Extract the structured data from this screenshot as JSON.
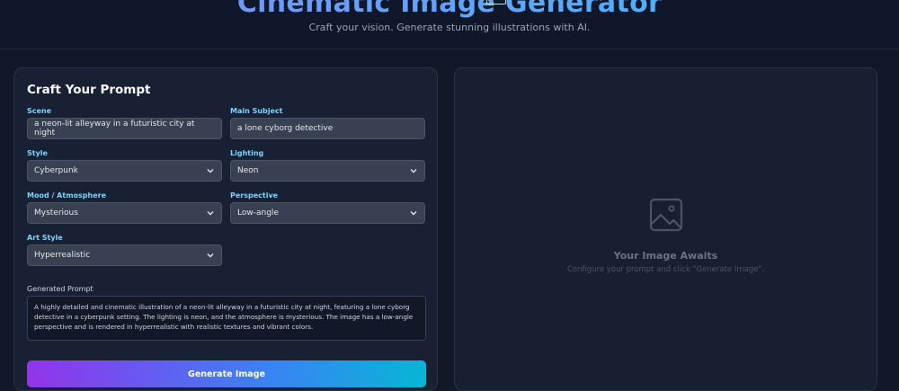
{
  "header": {
    "title": "Cinematic Image Generator",
    "subtitle": "Craft your vision. Generate stunning illustrations with AI."
  },
  "prompt_panel": {
    "title": "Craft Your Prompt",
    "scene": {
      "label": "Scene",
      "value": "a neon-lit alleyway in a futuristic city at night"
    },
    "subject": {
      "label": "Main Subject",
      "value": "a lone cyborg detective"
    },
    "style": {
      "label": "Style",
      "selected": "Cyberpunk"
    },
    "lighting": {
      "label": "Lighting",
      "selected": "Neon"
    },
    "mood": {
      "label": "Mood / Atmosphere",
      "selected": "Mysterious"
    },
    "perspective": {
      "label": "Perspective",
      "selected": "Low-angle"
    },
    "art_style": {
      "label": "Art Style",
      "selected": "Hyperrealistic"
    },
    "generated_prompt": {
      "label": "Generated Prompt",
      "text": "A highly detailed and cinematic illustration of a neon-lit alleyway in a futuristic city at night, featuring a lone cyborg detective in a cyberpunk setting. The lighting is neon, and the atmosphere is mysterious. The image has a low-angle perspective and is rendered in hyperrealistic with realistic textures and vibrant colors."
    },
    "generate_button": "Generate Image"
  },
  "preview_panel": {
    "title": "Your Image Awaits",
    "subtitle": "Configure your prompt and click \"Generate Image\".",
    "icon": "image-icon"
  },
  "colors": {
    "background": "#111827",
    "panel": "#182133",
    "label_accent": "#7dd3fc",
    "button_gradient_start": "#9333ea",
    "button_gradient_end": "#06b6d4"
  }
}
